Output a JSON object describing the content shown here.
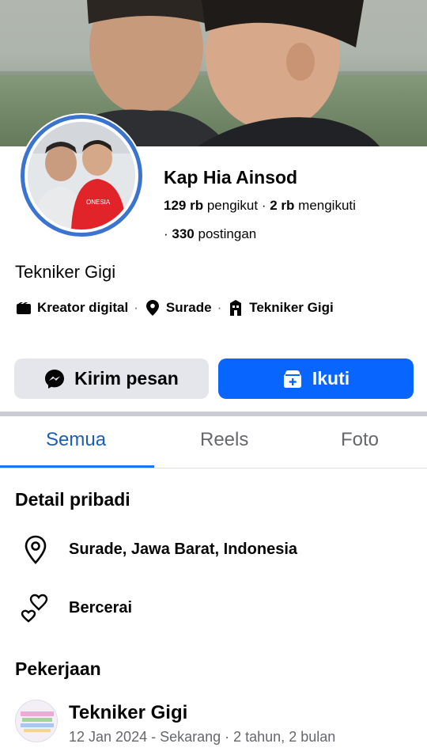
{
  "profile": {
    "name": "Kap Hia Ainsod",
    "followers_count": "129 rb",
    "followers_label": "pengikut",
    "following_count": "2 rb",
    "following_label": "mengikuti",
    "posts_count": "330",
    "posts_label": "postingan",
    "bio": "Tekniker Gigi",
    "meta": {
      "category": "Kreator digital",
      "location": "Surade",
      "work": "Tekniker Gigi"
    }
  },
  "actions": {
    "message_label": "Kirim pesan",
    "follow_label": "Ikuti"
  },
  "tabs": [
    {
      "label": "Semua",
      "active": true
    },
    {
      "label": "Reels",
      "active": false
    },
    {
      "label": "Foto",
      "active": false
    }
  ],
  "details": {
    "title": "Detail pribadi",
    "location": "Surade, Jawa Barat, Indonesia",
    "relationship": "Bercerai"
  },
  "work": {
    "title": "Pekerjaan",
    "job_title": "Tekniker Gigi",
    "period": "12 Jan 2024 - Sekarang · 2 tahun, 2 bulan"
  },
  "colors": {
    "accent": "#0866ff",
    "avatar_ring": "#3b73d1",
    "tab_active": "#1a5fb4"
  }
}
